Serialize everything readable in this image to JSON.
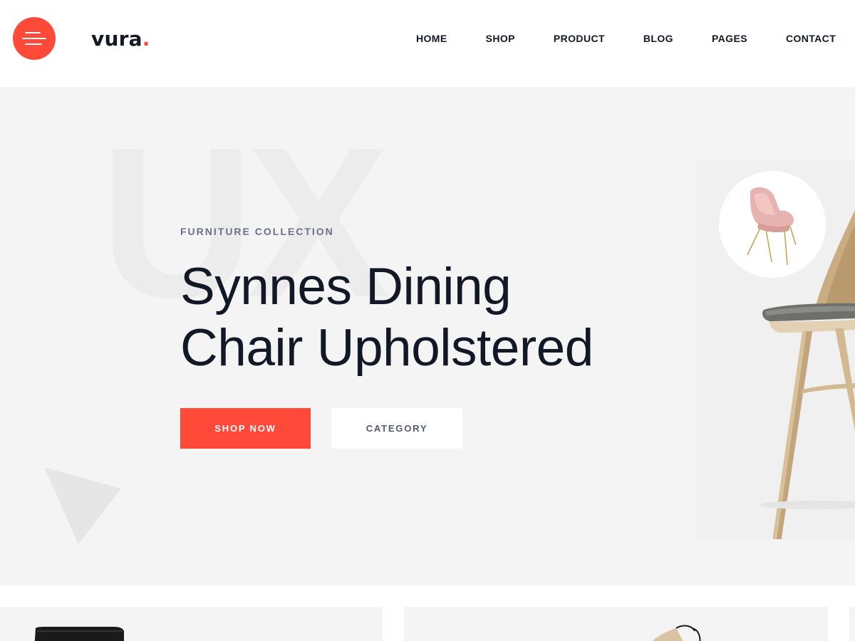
{
  "header": {
    "menu_icon": "hamburger-menu-icon",
    "logo": {
      "text": "vura",
      "dot": "."
    },
    "nav": [
      {
        "label": "HOME"
      },
      {
        "label": "SHOP"
      },
      {
        "label": "PRODUCT"
      },
      {
        "label": "BLOG"
      },
      {
        "label": "PAGES"
      },
      {
        "label": "CONTACT"
      }
    ]
  },
  "hero": {
    "background_text": "UX",
    "eyebrow": "FURNITURE COLLECTION",
    "title_line1": "Synnes Dining",
    "title_line2": "Chair Upholstered",
    "primary_button": "SHOP NOW",
    "secondary_button": "CATEGORY"
  },
  "colors": {
    "accent": "#ff4a3a",
    "text_dark": "#121826",
    "muted": "#6b7089",
    "hero_bg": "#f4f4f4"
  }
}
